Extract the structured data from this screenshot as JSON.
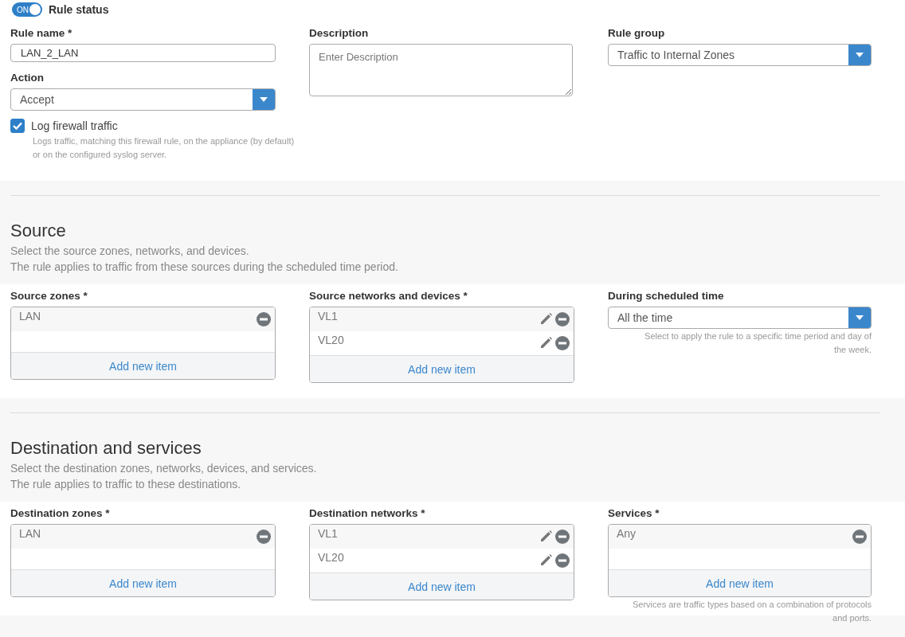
{
  "rule_status": {
    "label": "Rule status",
    "toggle_text": "ON",
    "on": true
  },
  "rule_name": {
    "label": "Rule name *",
    "value": "LAN_2_LAN"
  },
  "action": {
    "label": "Action",
    "value": "Accept"
  },
  "log_traffic": {
    "label": "Log firewall traffic",
    "checked": true,
    "help": "Logs traffic, matching this firewall rule, on the appliance (by default) or on the configured syslog server."
  },
  "description": {
    "label": "Description",
    "placeholder": "Enter Description"
  },
  "rule_group": {
    "label": "Rule group",
    "value": "Traffic to Internal Zones"
  },
  "sections": [
    {
      "title": "Source",
      "lines": [
        "Select the source zones, networks, and devices.",
        "The rule applies to traffic from these sources during the scheduled time period."
      ],
      "fields": [
        {
          "kind": "list",
          "label": "Source zones *",
          "items": [
            {
              "text": "LAN",
              "editable": false
            }
          ],
          "add_label": "Add new item"
        },
        {
          "kind": "list",
          "label": "Source networks and devices *",
          "items": [
            {
              "text": "VL1",
              "editable": true
            },
            {
              "text": "VL20",
              "editable": true
            }
          ],
          "add_label": "Add new item"
        },
        {
          "kind": "select",
          "label": "During scheduled time",
          "value": "All the time",
          "help": "Select to apply the rule to a specific time period and day of the week."
        }
      ]
    },
    {
      "title": "Destination and services",
      "lines": [
        "Select the destination zones, networks, devices, and services.",
        "The rule applies to traffic to these destinations."
      ],
      "fields": [
        {
          "kind": "list",
          "label": "Destination zones *",
          "items": [
            {
              "text": "LAN",
              "editable": false
            }
          ],
          "add_label": "Add new item"
        },
        {
          "kind": "list",
          "label": "Destination networks *",
          "items": [
            {
              "text": "VL1",
              "editable": true
            },
            {
              "text": "VL20",
              "editable": true
            }
          ],
          "add_label": "Add new item"
        },
        {
          "kind": "list",
          "label": "Services *",
          "items": [
            {
              "text": "Any",
              "editable": false
            }
          ],
          "add_label": "Add new item",
          "help": "Services are traffic types based on a combination of protocols and ports."
        }
      ]
    }
  ]
}
